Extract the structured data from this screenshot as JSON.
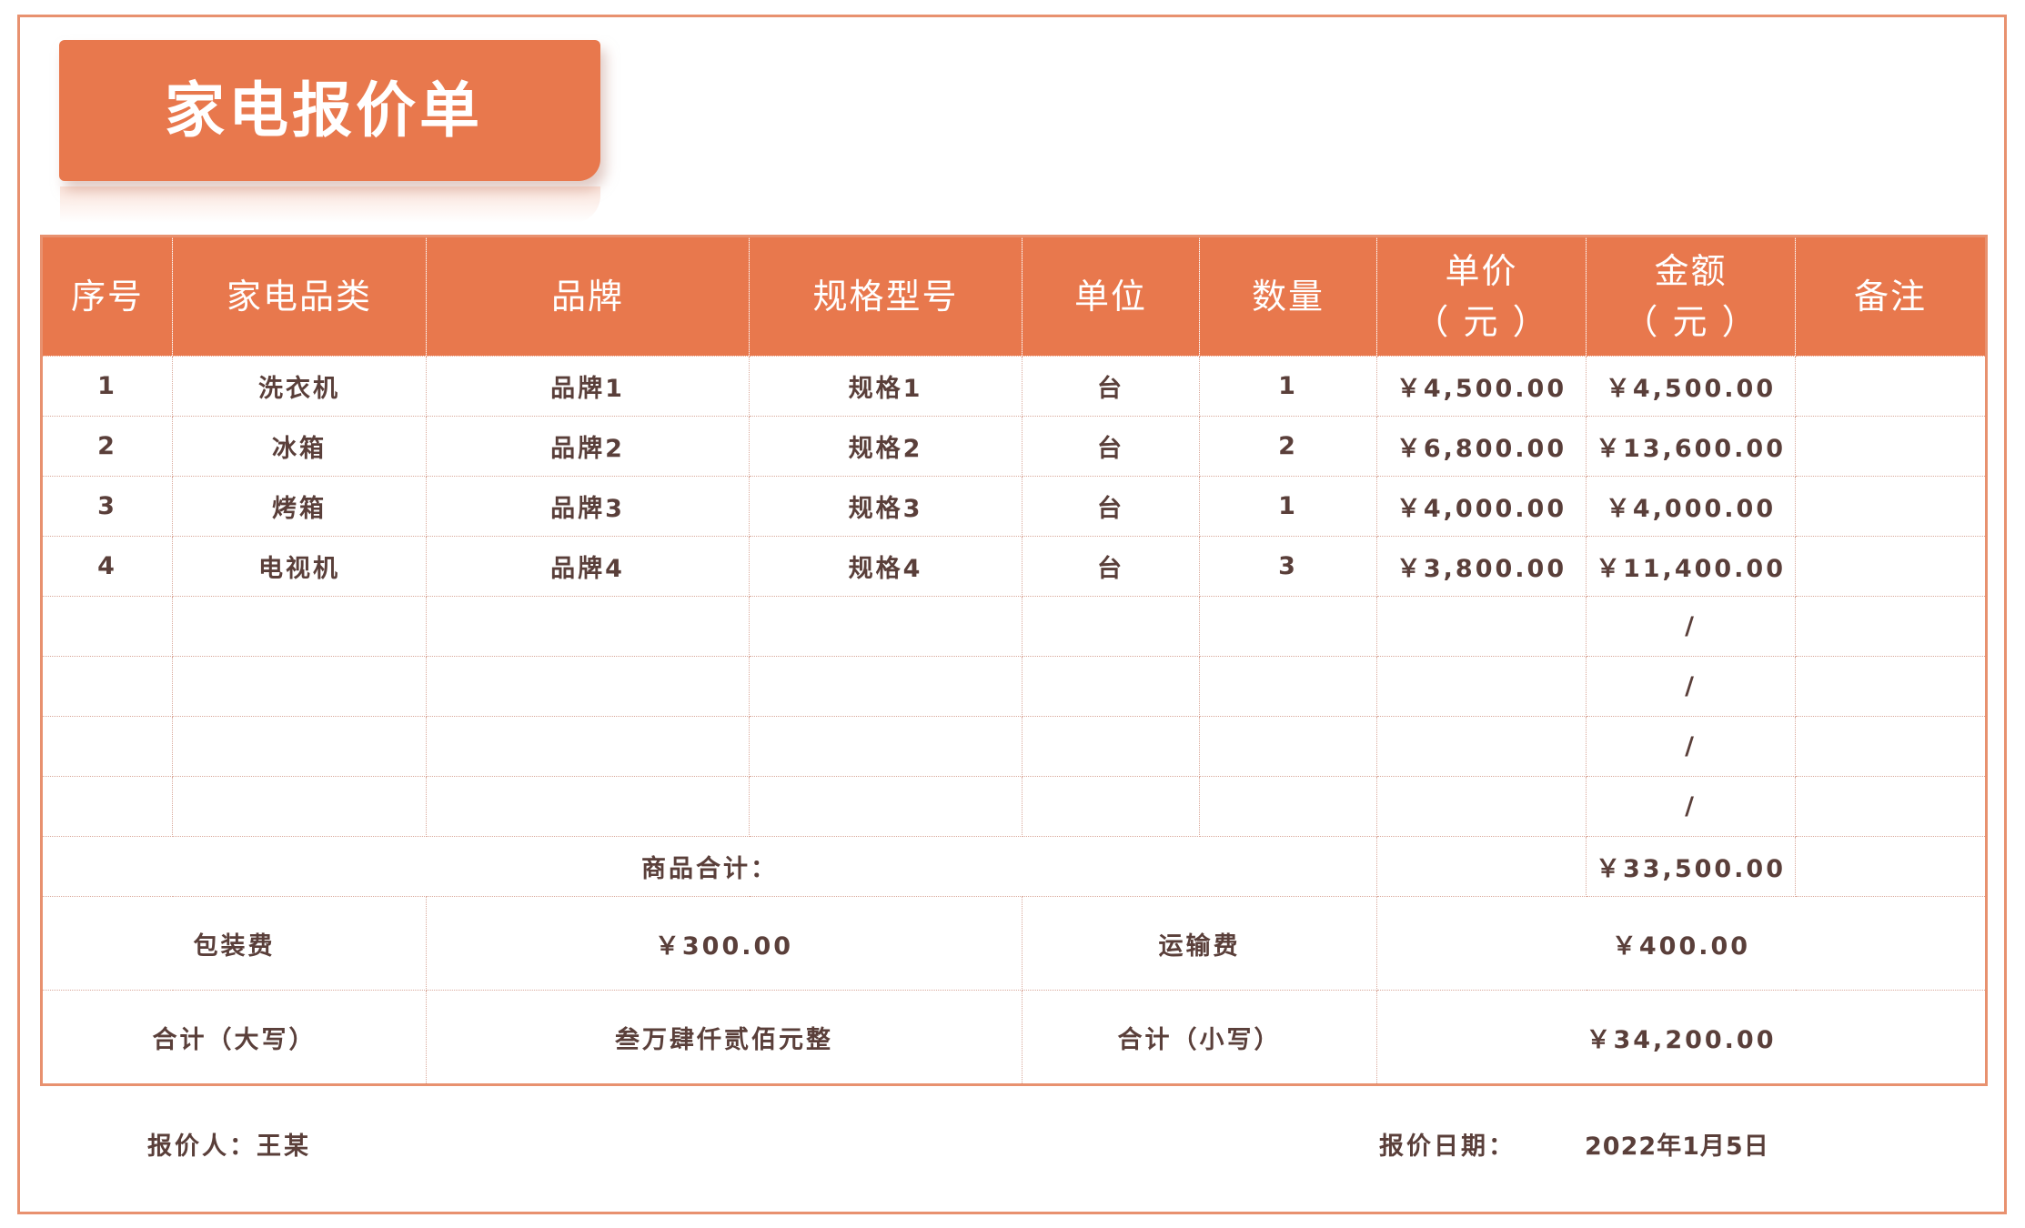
{
  "title": "家电报价单",
  "headers": {
    "seq": "序号",
    "category": "家电品类",
    "brand": "品牌",
    "model": "规格型号",
    "unit": "单位",
    "qty": "数量",
    "price": "单价",
    "price_unit": "（ 元 ）",
    "amount": "金额",
    "amount_unit": "（ 元 ）",
    "note": "备注"
  },
  "rows": [
    {
      "seq": "1",
      "category": "洗衣机",
      "brand": "品牌1",
      "model": "规格1",
      "unit": "台",
      "qty": "1",
      "price": "￥4,500.00",
      "amount": "￥4,500.00",
      "note": ""
    },
    {
      "seq": "2",
      "category": "冰箱",
      "brand": "品牌2",
      "model": "规格2",
      "unit": "台",
      "qty": "2",
      "price": "￥6,800.00",
      "amount": "￥13,600.00",
      "note": ""
    },
    {
      "seq": "3",
      "category": "烤箱",
      "brand": "品牌3",
      "model": "规格3",
      "unit": "台",
      "qty": "1",
      "price": "￥4,000.00",
      "amount": "￥4,000.00",
      "note": ""
    },
    {
      "seq": "4",
      "category": "电视机",
      "brand": "品牌4",
      "model": "规格4",
      "unit": "台",
      "qty": "3",
      "price": "￥3,800.00",
      "amount": "￥11,400.00",
      "note": ""
    }
  ],
  "blank_rows": [
    {
      "amount": "/"
    },
    {
      "amount": "/"
    },
    {
      "amount": "/"
    },
    {
      "amount": "/"
    }
  ],
  "subtotal": {
    "label": "商品合计：",
    "amount": "￥33,500.00"
  },
  "fees": {
    "packing_label": "包装费",
    "packing_value": "￥300.00",
    "shipping_label": "运输费",
    "shipping_value": "￥400.00"
  },
  "total": {
    "upper_label": "合计（大写）",
    "upper_value": "叁万肆仟贰佰元整",
    "lower_label": "合计（小写）",
    "lower_value": "￥34,200.00"
  },
  "footer": {
    "quoter": "报价人：王某",
    "date_label": "报价日期：",
    "date_value": "2022年1月5日"
  },
  "colors": {
    "accent": "#e8784d",
    "border": "#e8916f",
    "text": "#5a3f3a"
  }
}
